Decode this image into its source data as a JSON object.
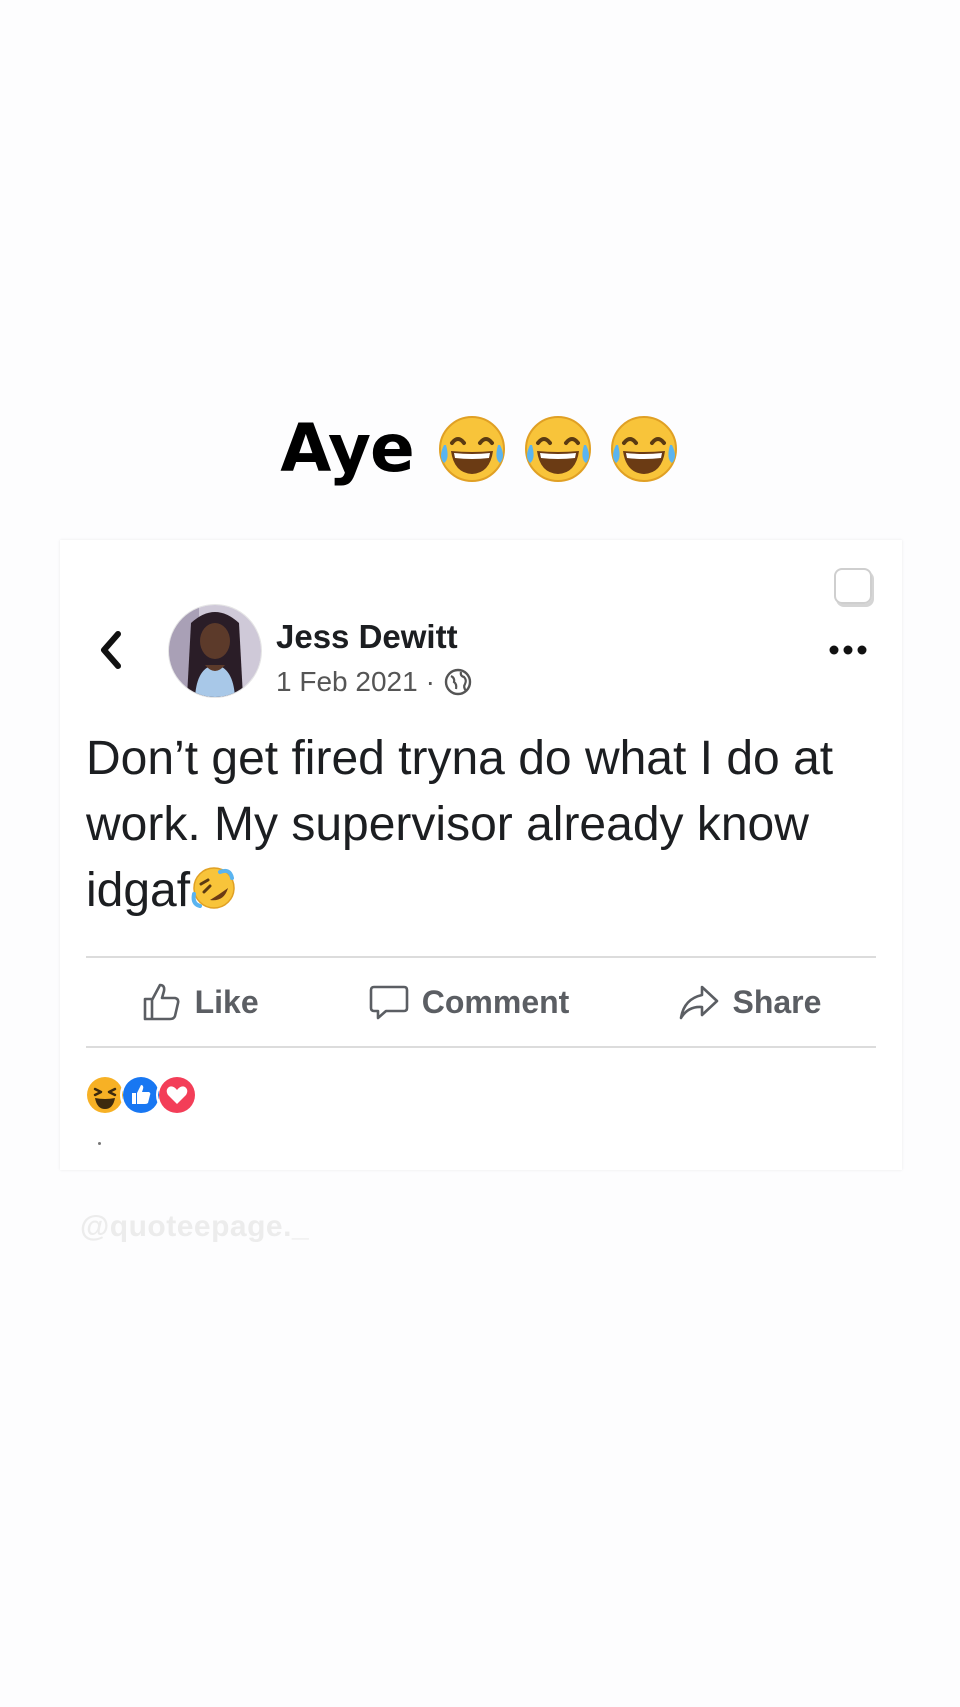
{
  "caption": {
    "text": "Aye",
    "emoji": [
      "tears-of-joy",
      "tears-of-joy",
      "tears-of-joy"
    ]
  },
  "post": {
    "author": "Jess Dewitt",
    "date": "1 Feb 2021",
    "separator": "·",
    "privacy_icon": "globe-icon",
    "text": "Don’t get fired tryna do what I do at work. My supervisor already know idgaf",
    "text_emoji": "rolling-on-floor-laughing",
    "actions": [
      {
        "label": "Like",
        "icon": "thumbs-up-icon"
      },
      {
        "label": "Comment",
        "icon": "comment-icon"
      },
      {
        "label": "Share",
        "icon": "share-icon"
      }
    ],
    "reactions": [
      "haha",
      "like",
      "love"
    ]
  },
  "watermark": "@quoteepage._",
  "colors": {
    "like_blue": "#1877f2",
    "love_red": "#f33e58",
    "haha_yellow": "#f7b125",
    "text_dark": "#1c1e21",
    "action_gray": "#5b5e63"
  }
}
